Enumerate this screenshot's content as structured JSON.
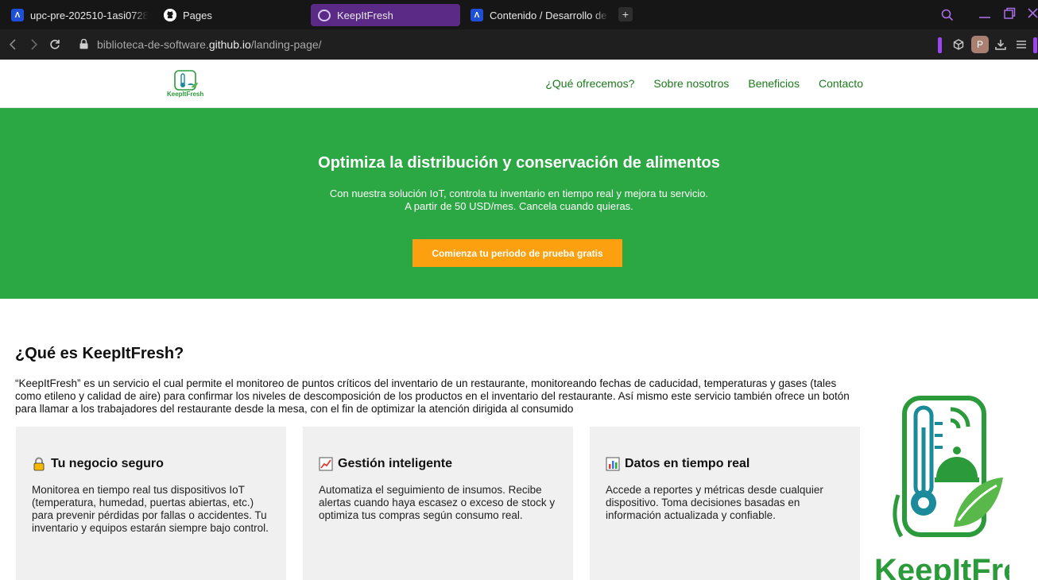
{
  "browser": {
    "tabs": [
      {
        "title": "upc-pre-202510-1asi0728",
        "active": false
      },
      {
        "title": "Pages",
        "active": false
      },
      {
        "title": "KeepItFresh",
        "active": true
      },
      {
        "title": "Contenido / Desarrollo de",
        "active": false
      }
    ],
    "new_tab_label": "+",
    "url_prefix": "biblioteca-de-software.",
    "url_domain": "github.io",
    "url_path": "/landing-page/",
    "profile_initial": "P",
    "accent_color": "#9b46f0"
  },
  "site": {
    "logo_text": "KeepItFresh",
    "nav": [
      "¿Qué ofrecemos?",
      "Sobre nosotros",
      "Beneficios",
      "Contacto"
    ],
    "hero": {
      "title": "Optimiza la distribución y conservación de alimentos",
      "subtitle_line1": "Con nuestra solución IoT, controla tu inventario en tiempo real y mejora tu servicio.",
      "subtitle_line2": "A partir de 50 USD/mes. Cancela cuando quieras.",
      "cta": "Comienza tu periodo de prueba gratis",
      "bg_color": "#2ba743",
      "cta_color": "#fca010"
    },
    "about": {
      "title": "¿Qué es KeepItFresh?",
      "text": "“KeepItFresh” es un servicio el cual permite el monitoreo de puntos críticos del inventario de un restaurante, monitoreando fechas de caducidad, temperaturas y gases (tales como etileno y calidad de aire) para confirmar los niveles de descomposición de los productos en el inventario del restaurante. Así mismo este servicio también ofrece un botón para llamar a los trabajadores del restaurante desde la mesa, con el fin de optimizar la atención dirigida al consumido"
    },
    "cards": [
      {
        "icon": "lock-icon",
        "title": "Tu negocio seguro",
        "text": "Monitorea en tiempo real tus dispositivos IoT (temperatura, humedad, puertas abiertas, etc.) para prevenir pérdidas por fallas o accidentes. Tu inventario y equipos estarán siempre bajo control."
      },
      {
        "icon": "chart-increasing-icon",
        "title": "Gestión inteligente",
        "text": "Automatiza el seguimiento de insumos. Recibe alertas cuando haya escasez o exceso de stock y optimiza tus compras según consumo real."
      },
      {
        "icon": "bar-chart-icon",
        "title": "Datos en tiempo real",
        "text": "Accede a reportes y métricas desde cualquier dispositivo. Toma decisiones basadas en información actualizada y confiable."
      }
    ],
    "big_logo_text": "KeepItFresh"
  }
}
